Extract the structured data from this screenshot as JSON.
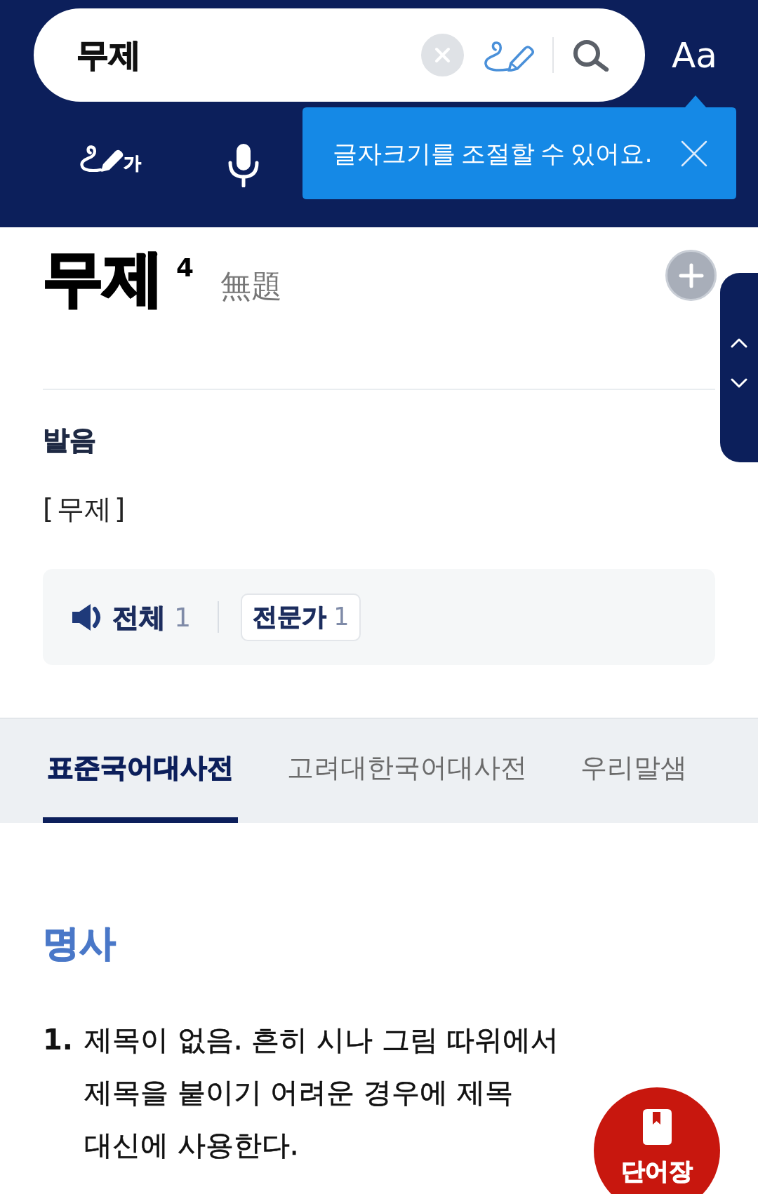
{
  "search_bar": {
    "value": "무제"
  },
  "font_size_button": {
    "label": "Aa"
  },
  "handwriting_button": {
    "glyph": "가"
  },
  "tooltip": {
    "text": "글자크기를 조절할 수 있어요."
  },
  "entry": {
    "headword": "무제",
    "homonym_number": "4",
    "hanja": "無題"
  },
  "pronunciation": {
    "heading": "발음",
    "reading": "[ 무제 ]",
    "audio": [
      {
        "kind": "speaker",
        "label": "전체",
        "count": "1"
      },
      {
        "kind": "boxed",
        "label": "전문가",
        "count": "1"
      }
    ]
  },
  "dictionary_tabs": [
    {
      "label": "표준국어대사전",
      "selected": true
    },
    {
      "label": "고려대한국어대사전",
      "selected": false
    },
    {
      "label": "우리말샘",
      "selected": false
    }
  ],
  "part_of_speech": "명사",
  "senses": [
    {
      "number": "1.",
      "definition": "제목이 없음. 흔히 시나 그림 따위에서 제목을 붙이기 어려운 경우에 제목 대신에 사용한다."
    }
  ],
  "wordbook_button": {
    "label": "단어장"
  }
}
